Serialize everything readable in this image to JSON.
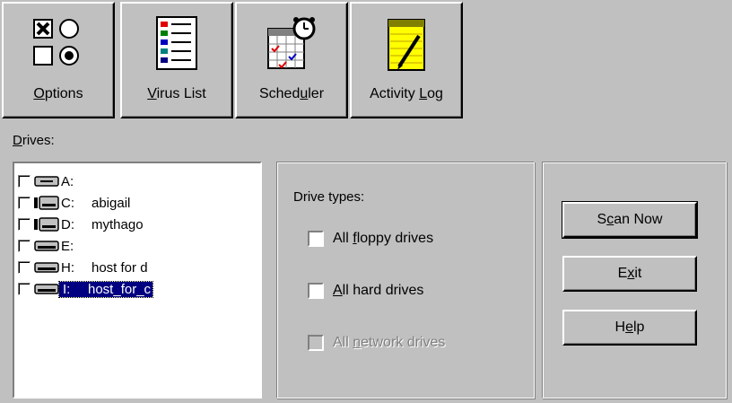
{
  "toolbar": {
    "items": [
      {
        "pre": "",
        "key": "O",
        "post": "ptions",
        "icon": "options-icon"
      },
      {
        "pre": "",
        "key": "V",
        "post": "irus List",
        "icon": "virus-list-icon"
      },
      {
        "pre": "Sched",
        "key": "u",
        "post": "ler",
        "icon": "scheduler-icon"
      },
      {
        "pre": "Activity ",
        "key": "L",
        "post": "og",
        "icon": "activity-log-icon"
      }
    ]
  },
  "drives": {
    "label_key": "D",
    "label_rest": "rives:",
    "items": [
      {
        "letter": "A:",
        "name": "",
        "type": "floppy",
        "checked": false,
        "selected": false
      },
      {
        "letter": "C:",
        "name": "abigail",
        "type": "hard",
        "checked": false,
        "selected": false
      },
      {
        "letter": "D:",
        "name": "mythago",
        "type": "hard",
        "checked": false,
        "selected": false
      },
      {
        "letter": "E:",
        "name": "",
        "type": "network",
        "checked": false,
        "selected": false
      },
      {
        "letter": "H:",
        "name": "host for d",
        "type": "network",
        "checked": false,
        "selected": false
      },
      {
        "letter": "I:",
        "name": "host_for_c",
        "type": "network",
        "checked": false,
        "selected": true
      }
    ]
  },
  "drive_types": {
    "title": "Drive types:",
    "options": [
      {
        "pre": "All ",
        "key": "f",
        "post": "loppy drives",
        "checked": false,
        "disabled": false
      },
      {
        "pre": "",
        "key": "A",
        "post": "ll hard drives",
        "checked": false,
        "disabled": false
      },
      {
        "pre": "All ",
        "key": "n",
        "post": "etwork drives",
        "checked": false,
        "disabled": true
      }
    ]
  },
  "actions": {
    "scan": {
      "pre": "S",
      "key": "c",
      "post": "an Now"
    },
    "exit": {
      "pre": "E",
      "key": "x",
      "post": "it"
    },
    "help": {
      "pre": "H",
      "key": "e",
      "post": "lp"
    }
  }
}
